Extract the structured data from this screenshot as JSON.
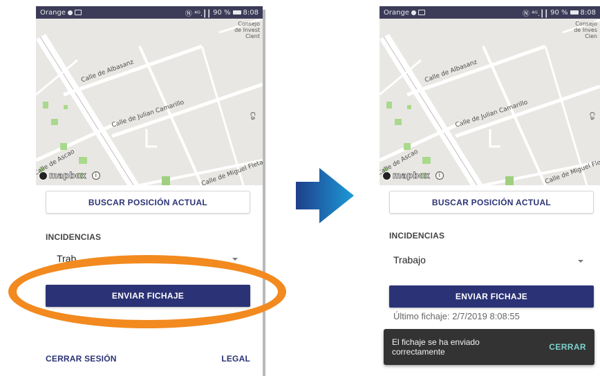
{
  "screens": {
    "before": {
      "status": {
        "carrier": "Orange",
        "signal": "Ⓝ ⁴ᴳ.┃┃",
        "battery": "90 %",
        "time": "8:08"
      },
      "map": {
        "streets": [
          "Calle de Albasanz",
          "Calle de Julian Camarillo",
          "Calle de Ascao",
          "Calle de Miguel Fleta",
          "Ca"
        ],
        "poi": "Consejo\nde Invest\nCient",
        "attribution": "mapbox"
      },
      "buttons": {
        "search_position": "BUSCAR POSICIÓN ACTUAL",
        "send_fichaje": "ENVIAR FICHAJE",
        "logout": "CERRAR SESIÓN",
        "legal": "LEGAL"
      },
      "incidencias": {
        "label": "INCIDENCIAS",
        "selected": "Trab"
      }
    },
    "after": {
      "status": {
        "carrier": "Orange",
        "signal": "Ⓝ ⁴ᴳ.┃┃",
        "battery": "90 %",
        "time": "8:08"
      },
      "map": {
        "streets": [
          "Calle de Albasanz",
          "Calle de Julian Camarillo",
          "Calle de Ascao",
          "Calle de Miguel Flet",
          "Ca"
        ],
        "poi": "Consejo\nde Inves\nCien",
        "attribution": "mapbox"
      },
      "buttons": {
        "search_position": "BUSCAR POSICIÓN ACTUAL",
        "send_fichaje": "ENVIAR FICHAJE"
      },
      "incidencias": {
        "label": "INCIDENCIAS",
        "selected": "Trabajo"
      },
      "last_fichaje": "Último fichaje: 2/7/2019 8:08:55",
      "snackbar": {
        "message": "El fichaje se ha enviado correctamente",
        "action": "CERRAR"
      }
    }
  },
  "colors": {
    "primary": "#2b3376",
    "highlight": "#f28a1f",
    "arrow": "#1d8fd2",
    "statusbar": "#3c3c58",
    "snackbar": "#333333",
    "snackbar_action": "#7fd3cf"
  }
}
